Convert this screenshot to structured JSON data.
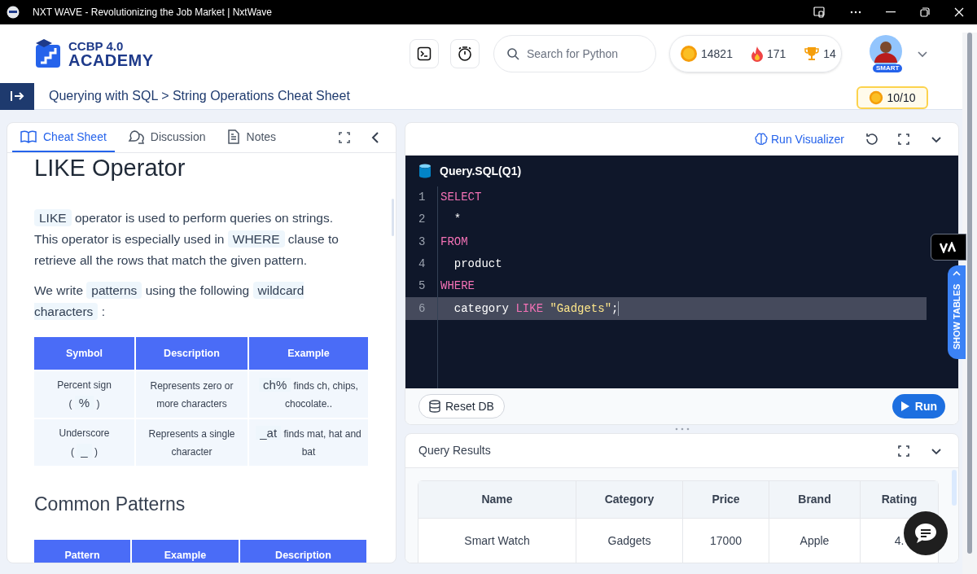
{
  "window": {
    "title": "NXT WAVE - Revolutionizing the Job Market | NxtWave"
  },
  "header": {
    "logo": {
      "line1": "CCBP 4.0",
      "line2": "ACADEMY"
    },
    "search": {
      "placeholder": "Search for Python"
    },
    "stats": [
      {
        "kind": "xp",
        "value": "14821"
      },
      {
        "kind": "streak",
        "value": "171"
      },
      {
        "kind": "trophy",
        "value": "14"
      }
    ],
    "avatar_badge": "SMART"
  },
  "breadcrumb": {
    "text": "Querying with SQL > String Operations Cheat Sheet",
    "xp": "10/10"
  },
  "left_panel": {
    "tabs": [
      {
        "kind": "book",
        "label": "Cheat Sheet",
        "selected": true
      },
      {
        "kind": "chat",
        "label": "Discussion",
        "selected": false
      },
      {
        "kind": "note",
        "label": "Notes",
        "selected": false
      }
    ],
    "heading": "LIKE Operator",
    "paragraphs": [
      [
        {
          "kind": "code",
          "text": "LIKE"
        },
        {
          "kind": "text",
          "text": "operator is used to perform queries on strings. This operator is especially used in"
        },
        {
          "kind": "code",
          "text": "WHERE"
        },
        {
          "kind": "text",
          "text": "clause to retrieve all the rows that match the given pattern."
        }
      ],
      [
        {
          "kind": "text",
          "text": "We write"
        },
        {
          "kind": "code",
          "text": "patterns"
        },
        {
          "kind": "text",
          "text": "using the following"
        },
        {
          "kind": "code",
          "text": "wildcard characters"
        },
        {
          "kind": "text",
          "text": ":"
        }
      ]
    ],
    "table": {
      "columns": [
        "Symbol",
        "Description",
        "Example"
      ],
      "rows": [
        [
          [
            [
              {
                "kind": "text",
                "text": "Percent sign"
              }
            ],
            [
              {
                "kind": "text",
                "text": "("
              },
              {
                "kind": "code",
                "text": "%"
              },
              {
                "kind": "text",
                "text": ")"
              }
            ]
          ],
          [
            [
              {
                "kind": "text",
                "text": "Represents zero or more characters"
              }
            ]
          ],
          [
            [
              {
                "kind": "code",
                "text": "ch%"
              },
              {
                "kind": "text",
                "text": "finds ch, chips, chocolate.."
              }
            ]
          ]
        ],
        [
          [
            [
              {
                "kind": "text",
                "text": "Underscore"
              }
            ],
            [
              {
                "kind": "text",
                "text": "("
              },
              {
                "kind": "code",
                "text": "_"
              },
              {
                "kind": "text",
                "text": ")"
              }
            ]
          ],
          [
            [
              {
                "kind": "text",
                "text": "Represents a single character"
              }
            ]
          ],
          [
            [
              {
                "kind": "code",
                "text": "_at"
              },
              {
                "kind": "text",
                "text": "finds mat, hat and bat"
              }
            ]
          ]
        ]
      ]
    },
    "heading2": "Common Patterns",
    "table2": {
      "columns": [
        "Pattern",
        "Example",
        "Description"
      ]
    }
  },
  "editor": {
    "visualizer": "Run Visualizer",
    "file": "Query.SQL(Q1)",
    "lines": [
      {
        "number": "1",
        "active": false,
        "tokens": [
          {
            "kind": "keyword",
            "text": "SELECT"
          }
        ]
      },
      {
        "number": "2",
        "active": false,
        "tokens": [
          {
            "kind": "plain",
            "text": "  *"
          }
        ]
      },
      {
        "number": "3",
        "active": false,
        "tokens": [
          {
            "kind": "keyword",
            "text": "FROM"
          }
        ]
      },
      {
        "number": "4",
        "active": false,
        "tokens": [
          {
            "kind": "plain",
            "text": "  product"
          }
        ]
      },
      {
        "number": "5",
        "active": false,
        "tokens": [
          {
            "kind": "keyword",
            "text": "WHERE"
          }
        ]
      },
      {
        "number": "6",
        "active": true,
        "tokens": [
          {
            "kind": "plain",
            "text": "  category "
          },
          {
            "kind": "keyword",
            "text": "LIKE"
          },
          {
            "kind": "string",
            "text": " \"Gadgets\""
          },
          {
            "kind": "plain",
            "text": ";"
          }
        ]
      }
    ],
    "reset": "Reset DB",
    "run": "Run"
  },
  "show_tables": "SHOW TABLES",
  "results": {
    "title": "Query Results",
    "columns": [
      "Name",
      "Category",
      "Price",
      "Brand",
      "Rating"
    ],
    "rows": [
      [
        "Smart Watch",
        "Gadgets",
        "17000",
        "Apple",
        "4."
      ]
    ]
  }
}
